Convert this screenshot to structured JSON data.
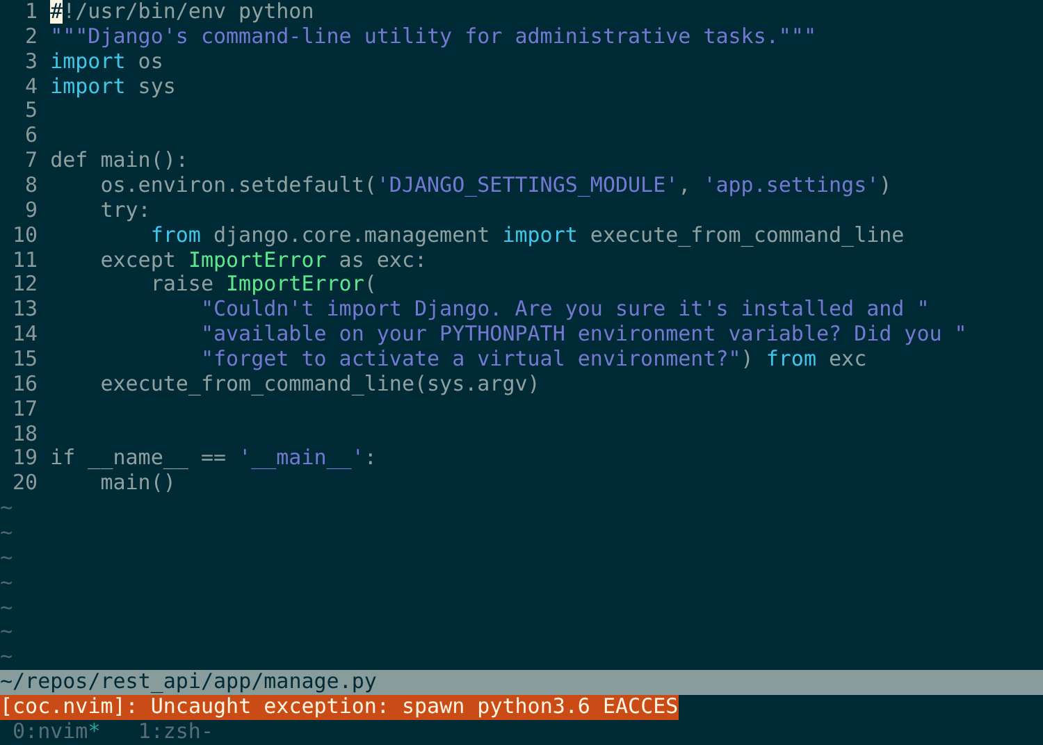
{
  "editor": {
    "lines": [
      {
        "number": "1",
        "segments": [
          {
            "kind": "cursor",
            "text": "#"
          },
          {
            "kind": "plain",
            "text": "!/usr/bin/env python"
          }
        ]
      },
      {
        "number": "2",
        "segments": [
          {
            "kind": "string",
            "text": "\"\"\"Django's command-line utility for administrative tasks.\"\"\""
          }
        ]
      },
      {
        "number": "3",
        "segments": [
          {
            "kind": "keyword",
            "text": "import"
          },
          {
            "kind": "plain",
            "text": " os"
          }
        ]
      },
      {
        "number": "4",
        "segments": [
          {
            "kind": "keyword",
            "text": "import"
          },
          {
            "kind": "plain",
            "text": " sys"
          }
        ]
      },
      {
        "number": "5"
      },
      {
        "number": "6"
      },
      {
        "number": "7",
        "segments": [
          {
            "kind": "plain",
            "text": "def main():"
          }
        ]
      },
      {
        "number": "8",
        "segments": [
          {
            "kind": "plain",
            "text": "    os.environ.setdefault("
          },
          {
            "kind": "string",
            "text": "'DJANGO_SETTINGS_MODULE'"
          },
          {
            "kind": "plain",
            "text": ", "
          },
          {
            "kind": "string",
            "text": "'app.settings'"
          },
          {
            "kind": "plain",
            "text": ")"
          }
        ]
      },
      {
        "number": "9",
        "segments": [
          {
            "kind": "plain",
            "text": "    try:"
          }
        ]
      },
      {
        "number": "10",
        "segments": [
          {
            "kind": "keyword",
            "text": "        from"
          },
          {
            "kind": "plain",
            "text": " django.core.management "
          },
          {
            "kind": "keyword",
            "text": "import"
          },
          {
            "kind": "plain",
            "text": " execute_from_command_line"
          }
        ]
      },
      {
        "number": "11",
        "segments": [
          {
            "kind": "plain",
            "text": "    except "
          },
          {
            "kind": "type",
            "text": "ImportError"
          },
          {
            "kind": "plain",
            "text": " as exc:"
          }
        ]
      },
      {
        "number": "12",
        "segments": [
          {
            "kind": "plain",
            "text": "        raise "
          },
          {
            "kind": "type",
            "text": "ImportError"
          },
          {
            "kind": "plain",
            "text": "("
          }
        ]
      },
      {
        "number": "13",
        "segments": [
          {
            "kind": "string",
            "text": "            \"Couldn't import Django. Are you sure it's installed and \""
          }
        ]
      },
      {
        "number": "14",
        "segments": [
          {
            "kind": "string",
            "text": "            \"available on your PYTHONPATH environment variable? Did you \""
          }
        ]
      },
      {
        "number": "15",
        "segments": [
          {
            "kind": "string",
            "text": "            \"forget to activate a virtual environment?\""
          },
          {
            "kind": "plain",
            "text": ") "
          },
          {
            "kind": "keyword",
            "text": "from"
          },
          {
            "kind": "plain",
            "text": " exc"
          }
        ]
      },
      {
        "number": "16",
        "segments": [
          {
            "kind": "plain",
            "text": "    execute_from_command_line(sys.argv)"
          }
        ]
      },
      {
        "number": "17"
      },
      {
        "number": "18"
      },
      {
        "number": "19",
        "segments": [
          {
            "kind": "plain",
            "text": "if __name__ == "
          },
          {
            "kind": "string",
            "text": "'__main__'"
          },
          {
            "kind": "plain",
            "text": ":"
          }
        ]
      },
      {
        "number": "20",
        "segments": [
          {
            "kind": "plain",
            "text": "    main()"
          }
        ]
      }
    ],
    "empty_line_markers": [
      "~",
      "~",
      "~",
      "~",
      "~",
      "~",
      "~"
    ]
  },
  "status_line": {
    "file_path": "~/repos/rest_api/app/manage.py"
  },
  "message": {
    "text": "[coc.nvim]: Uncaught exception: spawn python3.6 EACCES"
  },
  "tmux_windows": [
    {
      "label": "0:nvim",
      "flag": "*",
      "current": true
    },
    {
      "label": "1:zsh",
      "flag": "-",
      "current": false
    }
  ]
}
